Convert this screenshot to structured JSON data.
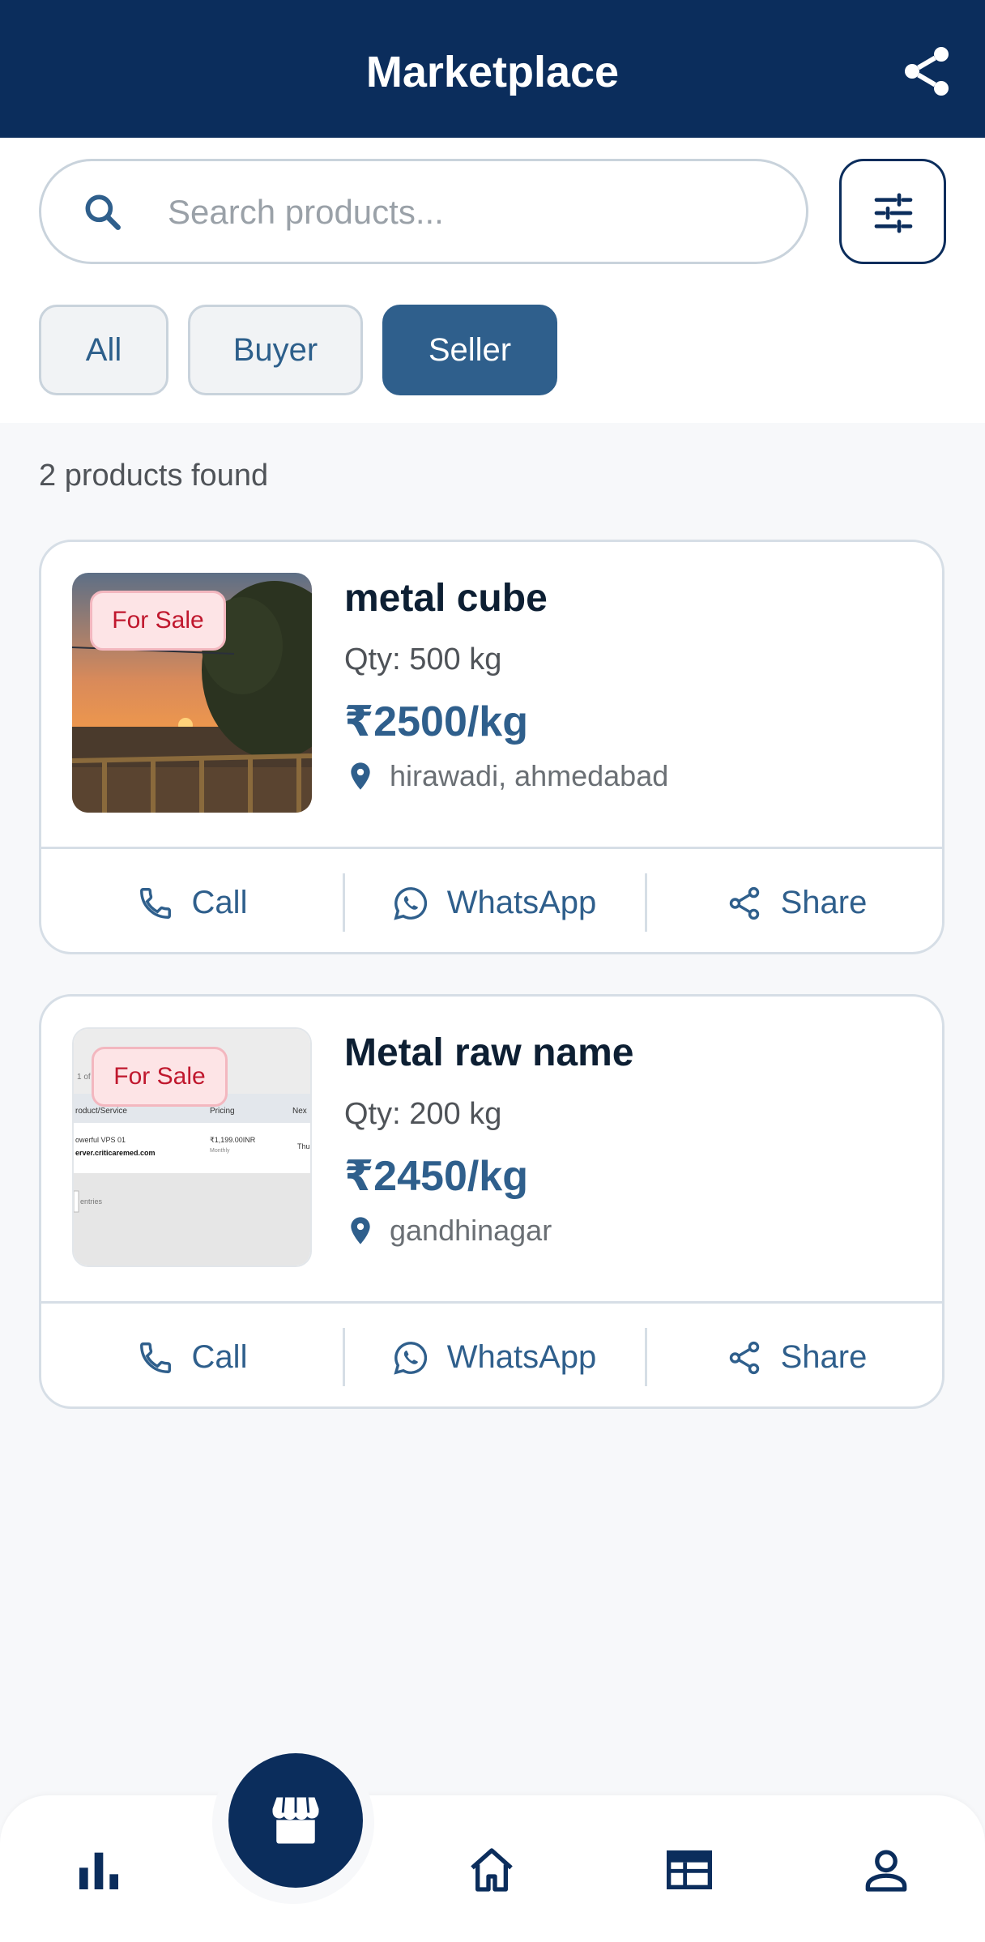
{
  "header": {
    "title": "Marketplace",
    "share_icon": "share-icon"
  },
  "search": {
    "placeholder": "Search products...",
    "value": ""
  },
  "filters": {
    "chips": [
      {
        "label": "All",
        "active": false
      },
      {
        "label": "Buyer",
        "active": false
      },
      {
        "label": "Seller",
        "active": true
      }
    ]
  },
  "results": {
    "count_text": "2 products found"
  },
  "products": [
    {
      "badge": "For Sale",
      "name": "metal cube",
      "qty": "Qty: 500 kg",
      "price": "₹2500/kg",
      "location": "hirawadi, ahmedabad",
      "image": "sunset-photo",
      "actions": {
        "call": "Call",
        "whatsapp": "WhatsApp",
        "share": "Share"
      }
    },
    {
      "badge": "For Sale",
      "name": "Metal raw name",
      "qty": "Qty: 200 kg",
      "price": "₹2450/kg",
      "location": "gandhinagar",
      "image": "table-screenshot",
      "thumb_table": {
        "corner": "1 of",
        "headers": [
          "roduct/Service",
          "Pricing",
          "Nex"
        ],
        "row1": "owerful VPS 01",
        "row2": "erver.criticaremed.com",
        "price": "₹1,199.00INR",
        "cycle": "Monthly",
        "next": "Thu",
        "footer": "entries"
      },
      "actions": {
        "call": "Call",
        "whatsapp": "WhatsApp",
        "share": "Share"
      }
    }
  ],
  "bottom_nav": {
    "items": [
      "stats-icon",
      "store-icon",
      "home-icon",
      "newspaper-icon",
      "profile-icon"
    ],
    "active": "store-icon"
  },
  "colors": {
    "primary": "#0b2d5c",
    "accent": "#2f5f8c",
    "badge_text": "#c0182e",
    "badge_bg": "#fde4e6"
  }
}
